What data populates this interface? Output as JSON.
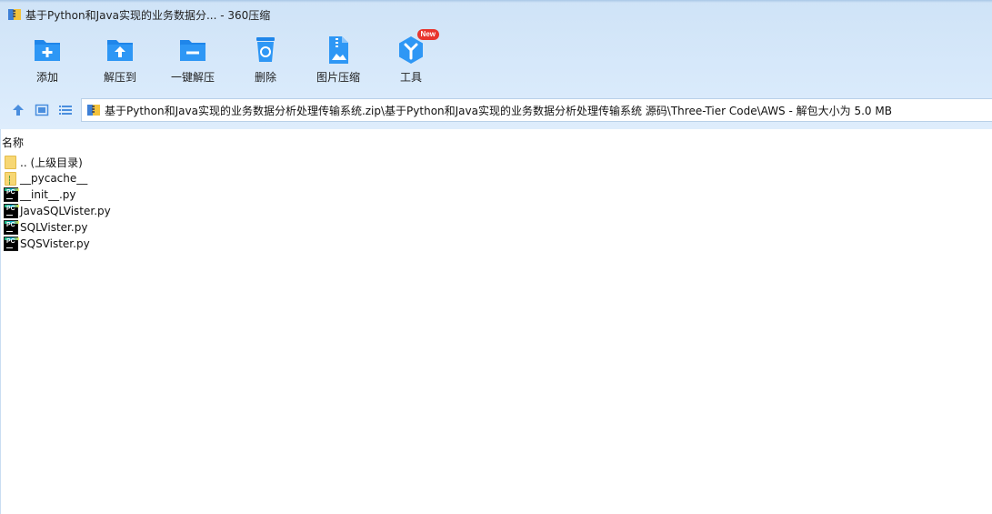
{
  "window": {
    "title": "基于Python和Java实现的业务数据分... - 360压缩"
  },
  "toolbar": {
    "items": [
      {
        "label": "添加",
        "icon": "add-file-icon"
      },
      {
        "label": "解压到",
        "icon": "extract-to-icon"
      },
      {
        "label": "一键解压",
        "icon": "one-click-extract-icon"
      },
      {
        "label": "删除",
        "icon": "recycle-bin-icon"
      },
      {
        "label": "图片压缩",
        "icon": "image-compress-icon"
      },
      {
        "label": "工具",
        "icon": "tools-icon",
        "badge": "New"
      }
    ]
  },
  "nav": {
    "path": "基于Python和Java实现的业务数据分析处理传输系统.zip\\基于Python和Java实现的业务数据分析处理传输系统 源码\\Three-Tier Code\\AWS - 解包大小为 5.0 MB"
  },
  "list": {
    "column_name": "名称",
    "items": [
      {
        "name": ".. (上级目录)",
        "type": "folder"
      },
      {
        "name": "__pycache__",
        "type": "folder"
      },
      {
        "name": "__init__.py",
        "type": "py"
      },
      {
        "name": "JavaSQLVister.py",
        "type": "py"
      },
      {
        "name": "SQLVister.py",
        "type": "py"
      },
      {
        "name": "SQSVister.py",
        "type": "py"
      }
    ]
  },
  "colors": {
    "accent": "#2b8ff0",
    "chrome_bg": "#d9eafb",
    "badge": "#e8352e"
  }
}
